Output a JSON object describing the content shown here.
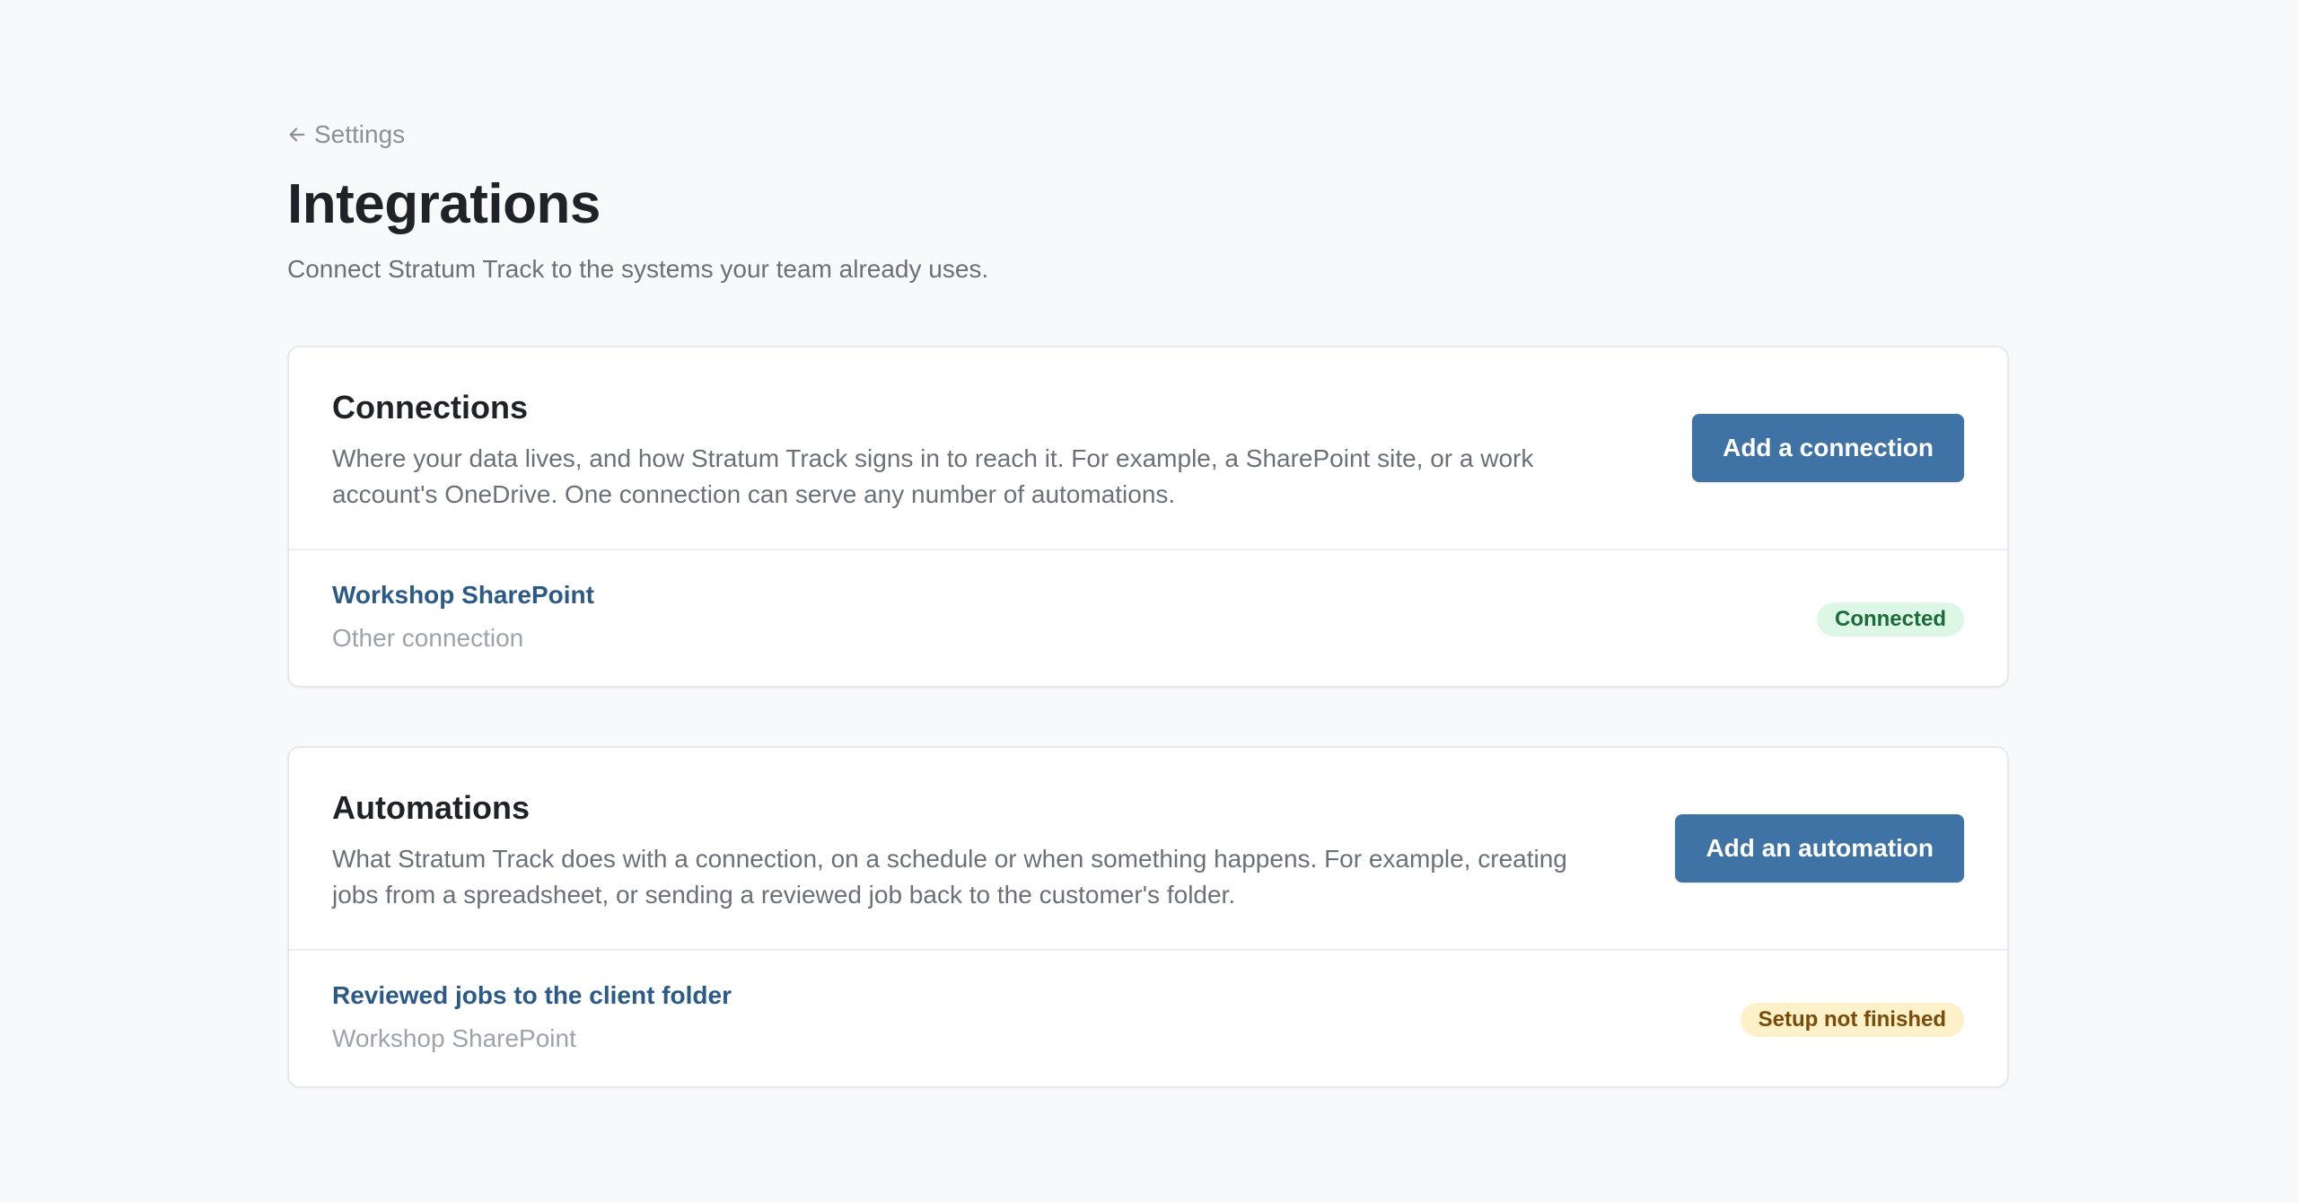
{
  "nav": {
    "back_label": "Settings"
  },
  "header": {
    "title": "Integrations",
    "subtitle": "Connect Stratum Track to the systems your team already uses."
  },
  "connections": {
    "title": "Connections",
    "description": "Where your data lives, and how Stratum Track signs in to reach it. For example, a SharePoint site, or a work account's OneDrive. One connection can serve any number of automations.",
    "add_label": "Add a connection",
    "items": [
      {
        "name": "Workshop SharePoint",
        "type": "Other connection",
        "status": "Connected"
      }
    ]
  },
  "automations": {
    "title": "Automations",
    "description": "What Stratum Track does with a connection, on a schedule or when something happens. For example, creating jobs from a spreadsheet, or sending a reviewed job back to the customer's folder.",
    "add_label": "Add an automation",
    "items": [
      {
        "name": "Reviewed jobs to the client folder",
        "connection": "Workshop SharePoint",
        "status": "Setup not finished"
      }
    ]
  },
  "colors": {
    "background": "#f8f9fb",
    "primary": "#3f73a6",
    "link": "#2b5a87",
    "success_bg": "#dcf7e6",
    "success_text": "#1d6a3a",
    "warning_bg": "#fdf1c9",
    "warning_text": "#7a4b08"
  },
  "icons": {
    "back": "arrow-left-icon"
  }
}
